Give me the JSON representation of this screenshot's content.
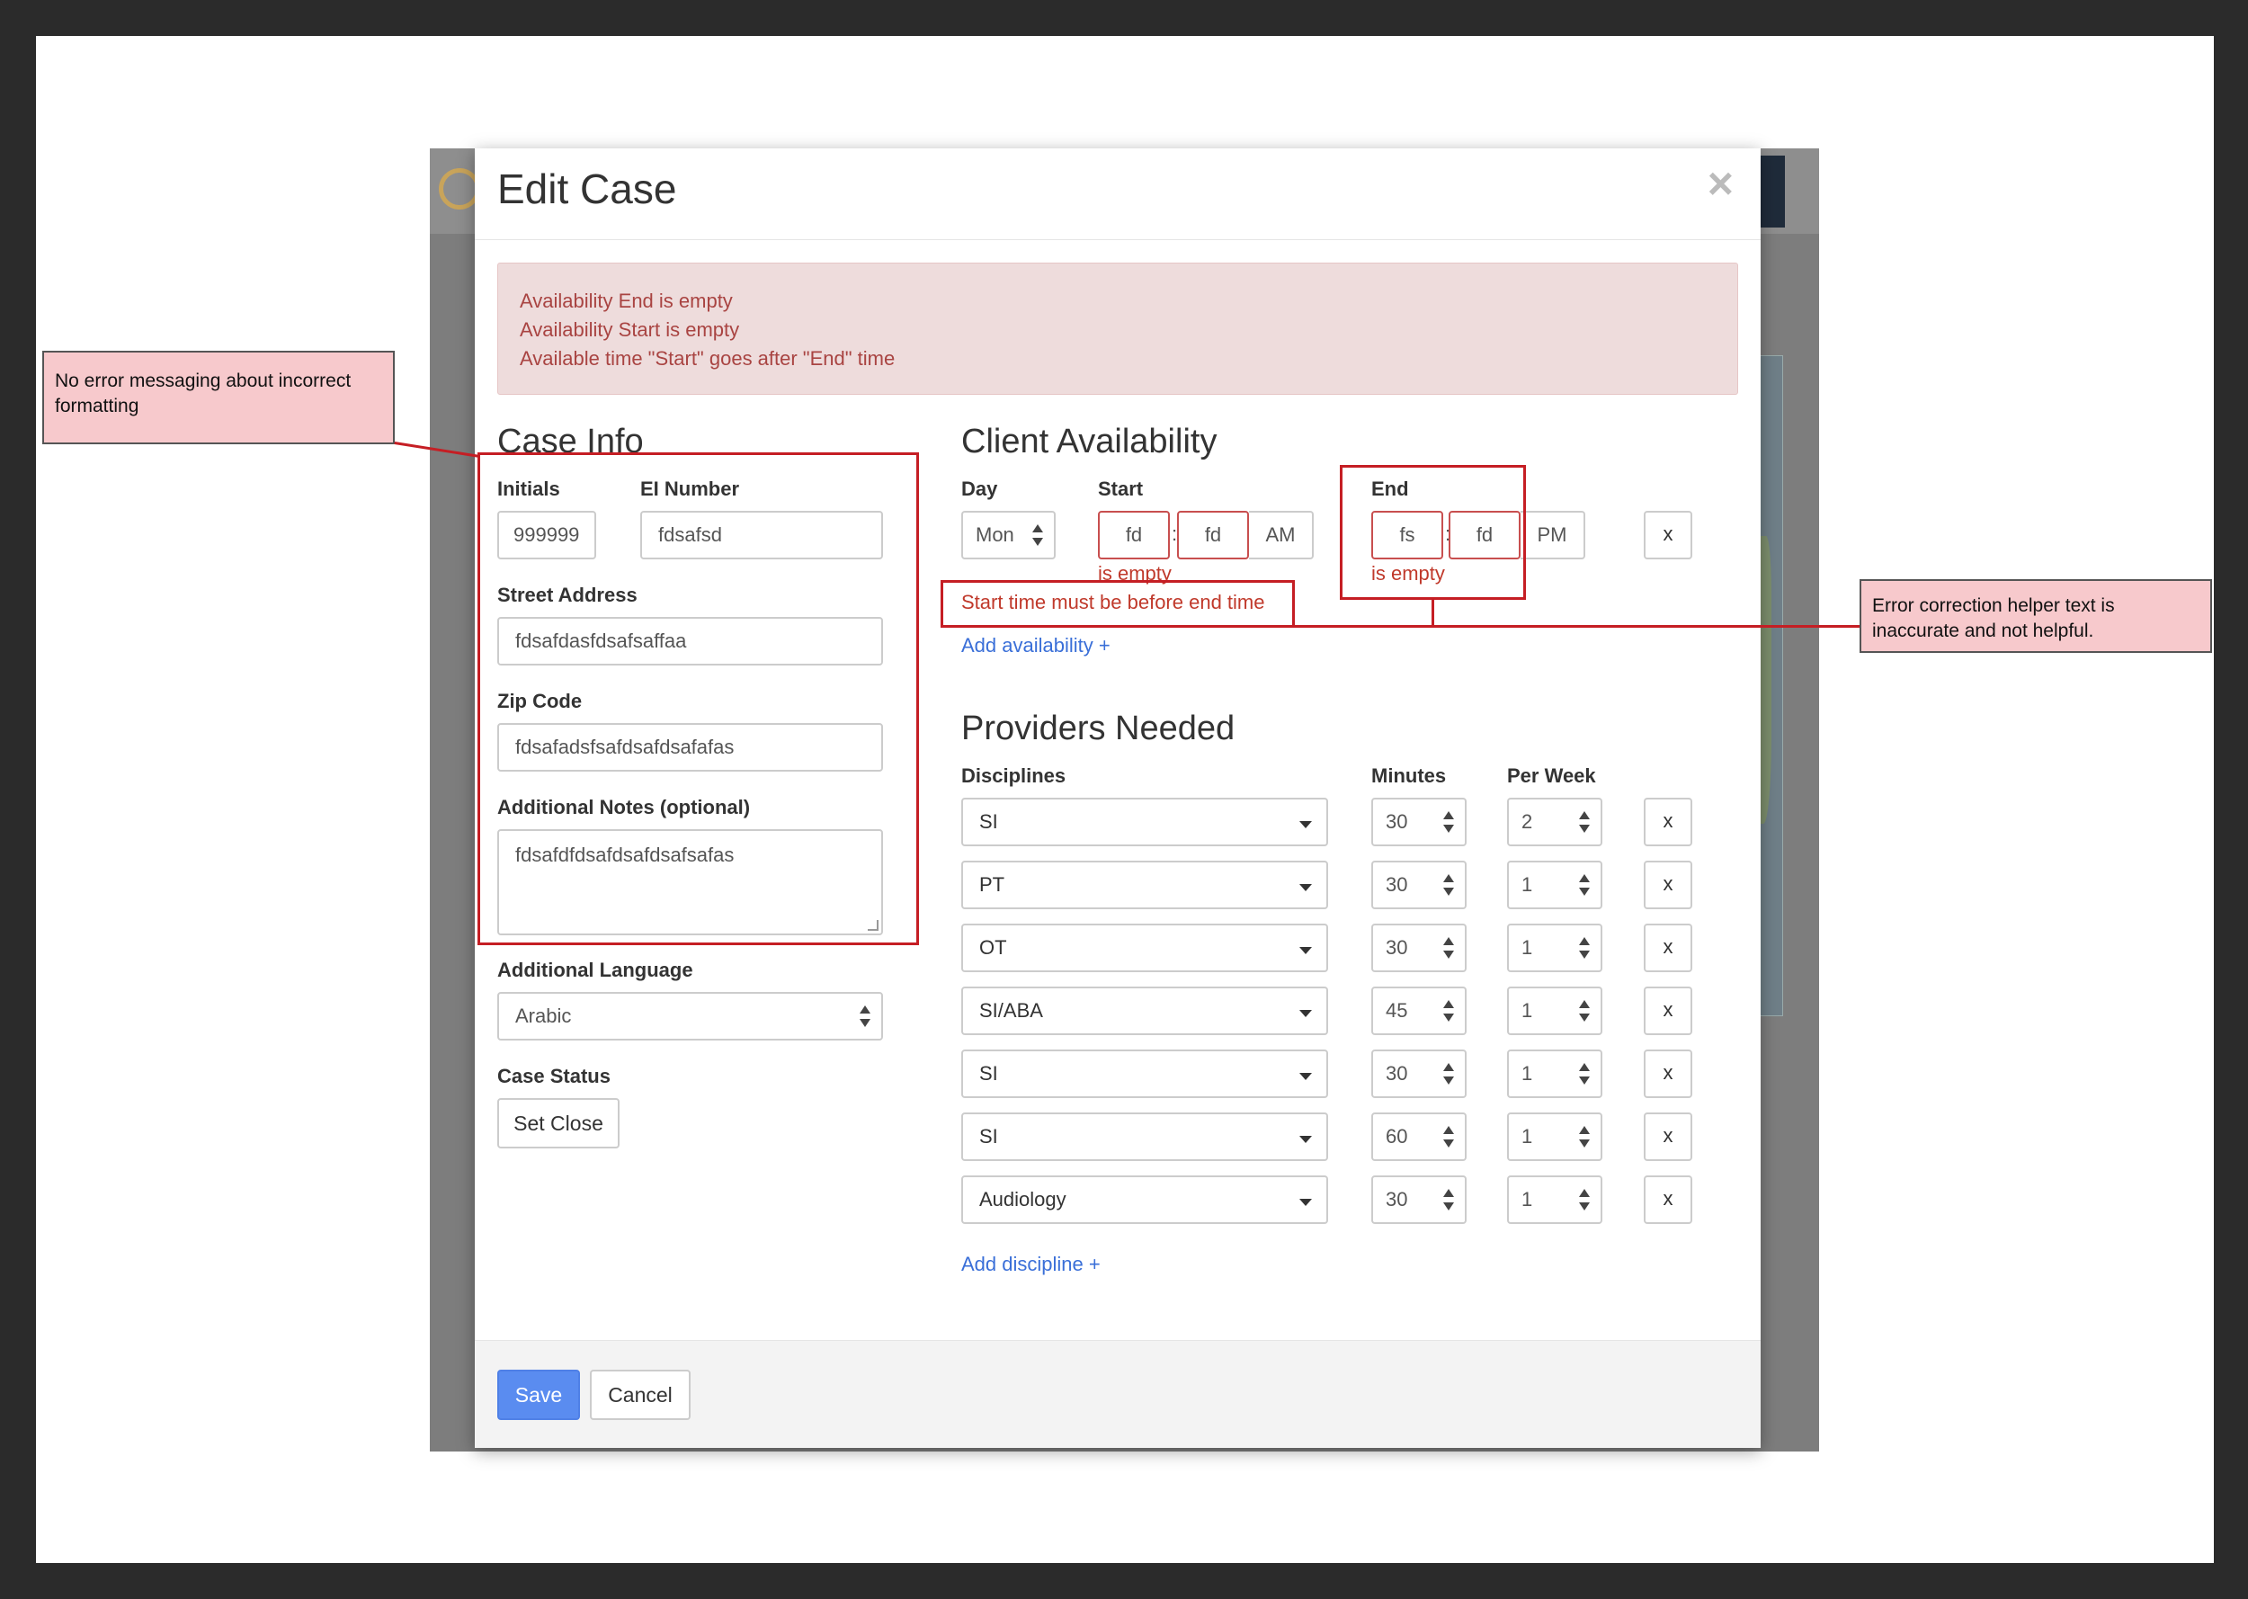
{
  "modal": {
    "title": "Edit Case",
    "close": "×"
  },
  "alert": {
    "lines": [
      "Availability End is empty",
      "Availability Start is empty",
      "Available time \"Start\" goes after \"End\" time"
    ]
  },
  "case_info": {
    "title": "Case Info",
    "initials_label": "Initials",
    "initials_value": "999999",
    "ei_label": "EI Number",
    "ei_value": "fdsafsd",
    "street_label": "Street Address",
    "street_value": "fdsafdasfdsafsaffaa",
    "zip_label": "Zip Code",
    "zip_value": "fdsafadsfsafdsafdsafafas",
    "notes_label": "Additional Notes (optional)",
    "notes_value": "fdsafdfdsafdsafdsafsafas",
    "language_label": "Additional Language",
    "language_value": "Arabic",
    "status_label": "Case Status",
    "status_button": "Set Close"
  },
  "availability": {
    "title": "Client Availability",
    "day_label": "Day",
    "start_label": "Start",
    "end_label": "End",
    "day_value": "Mon",
    "start_hour": "fd",
    "start_min": "fd",
    "start_ampm": "AM",
    "end_hour": "fs",
    "end_min": "fd",
    "end_ampm": "PM",
    "colon": ":",
    "start_error": "is empty",
    "end_error": "is empty",
    "order_error": "Start time must be before end time",
    "remove": "x",
    "add_link": "Add availability +"
  },
  "providers": {
    "title": "Providers Needed",
    "disciplines_label": "Disciplines",
    "minutes_label": "Minutes",
    "per_week_label": "Per Week",
    "rows": [
      {
        "discipline": "SI",
        "minutes": "30",
        "per_week": "2",
        "remove": "x"
      },
      {
        "discipline": "PT",
        "minutes": "30",
        "per_week": "1",
        "remove": "x"
      },
      {
        "discipline": "OT",
        "minutes": "30",
        "per_week": "1",
        "remove": "x"
      },
      {
        "discipline": "SI/ABA",
        "minutes": "45",
        "per_week": "1",
        "remove": "x"
      },
      {
        "discipline": "SI",
        "minutes": "30",
        "per_week": "1",
        "remove": "x"
      },
      {
        "discipline": "SI",
        "minutes": "60",
        "per_week": "1",
        "remove": "x"
      },
      {
        "discipline": "Audiology",
        "minutes": "30",
        "per_week": "1",
        "remove": "x"
      }
    ],
    "add_link": "Add discipline +"
  },
  "footer": {
    "save": "Save",
    "cancel": "Cancel"
  },
  "annotations": {
    "left_note": "No error messaging about incorrect formatting",
    "right_note": "Error correction helper text is inaccurate and not helpful."
  },
  "colors": {
    "annotation_red": "#c51e24",
    "note_fill": "#f7c9cc",
    "error_text": "#a94442",
    "primary": "#5a8cf0",
    "link": "#3a6fd8"
  }
}
